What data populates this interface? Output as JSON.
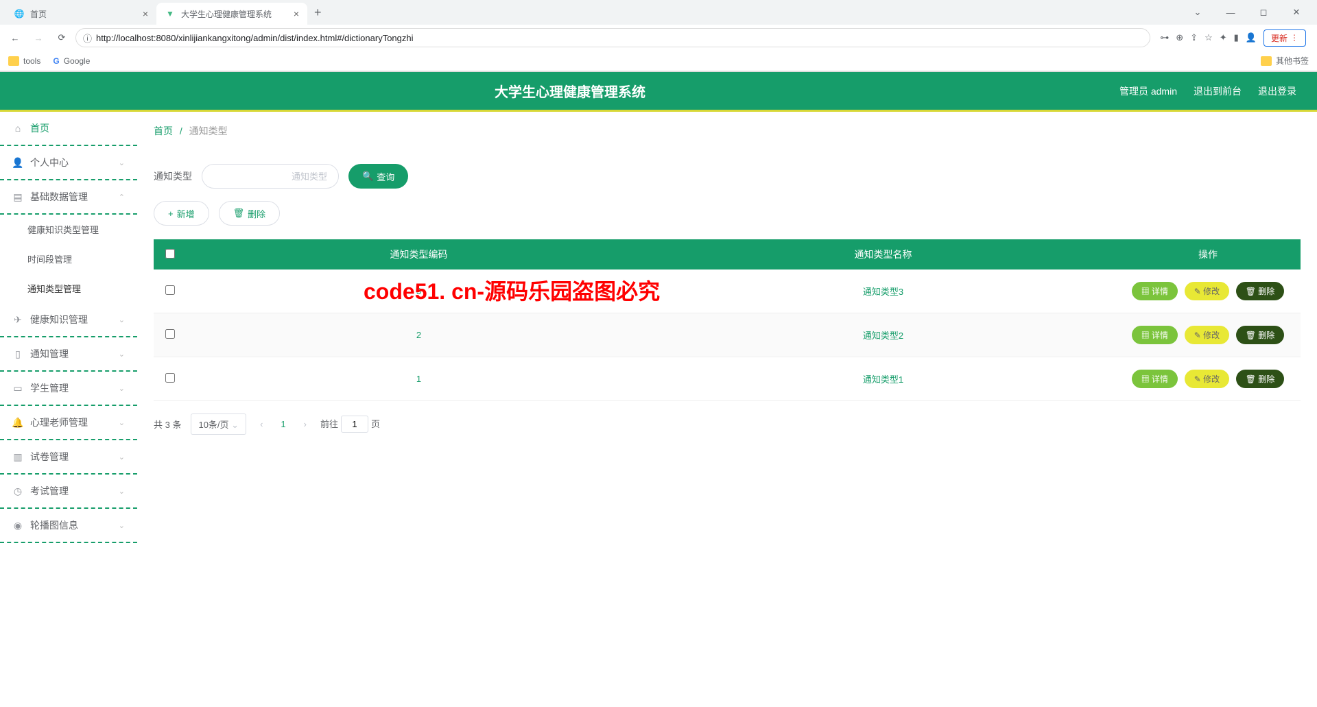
{
  "browser": {
    "tabs": [
      {
        "title": "首页",
        "active": false
      },
      {
        "title": "大学生心理健康管理系统",
        "active": true
      }
    ],
    "url": "http://localhost:8080/xinlijiankangxitong/admin/dist/index.html#/dictionaryTongzhi",
    "update_label": "更新",
    "bookmarks": {
      "tools": "tools",
      "google": "Google",
      "other": "其他书签"
    }
  },
  "header": {
    "title": "大学生心理健康管理系统",
    "admin_label": "管理员 admin",
    "exit_front": "退出到前台",
    "logout": "退出登录"
  },
  "sidebar": {
    "home": "首页",
    "personal": "个人中心",
    "basic_data": "基础数据管理",
    "sub_health_type": "健康知识类型管理",
    "sub_time": "时间段管理",
    "sub_notice_type": "通知类型管理",
    "health_knowledge": "健康知识管理",
    "notice": "通知管理",
    "student": "学生管理",
    "psych_teacher": "心理老师管理",
    "exam_paper": "试卷管理",
    "exam": "考试管理",
    "carousel": "轮播图信息"
  },
  "breadcrumb": {
    "home": "首页",
    "current": "通知类型"
  },
  "search": {
    "label": "通知类型",
    "placeholder": "通知类型",
    "query_btn": "查询"
  },
  "actions": {
    "add": "新增",
    "delete": "删除"
  },
  "table": {
    "col_code": "通知类型编码",
    "col_name": "通知类型名称",
    "col_ops": "操作",
    "detail": "详情",
    "edit": "修改",
    "del": "删除",
    "rows": [
      {
        "code": "3",
        "name": "通知类型3"
      },
      {
        "code": "2",
        "name": "通知类型2"
      },
      {
        "code": "1",
        "name": "通知类型1"
      }
    ]
  },
  "pagination": {
    "total": "共 3 条",
    "size": "10条/页",
    "current": "1",
    "goto_prefix": "前往",
    "goto_suffix": "页",
    "goto_value": "1"
  },
  "watermark": "code51. cn-源码乐园盗图必究"
}
